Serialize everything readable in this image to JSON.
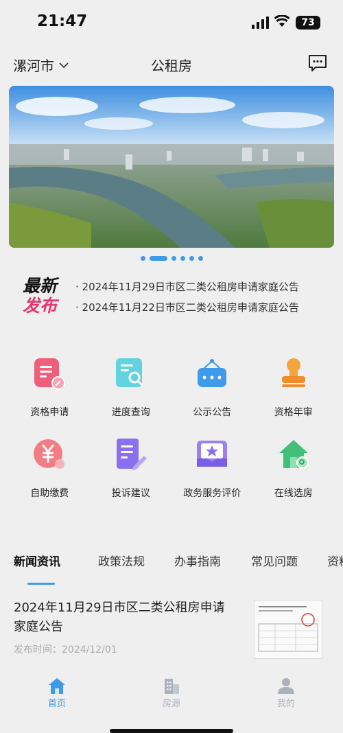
{
  "status_bar": {
    "time": "21:47",
    "battery": "73"
  },
  "header": {
    "city": "漯河市",
    "title": "公租房"
  },
  "banner": {
    "slide_count": 6,
    "active_index": 1
  },
  "latest_news": {
    "logo_line1": "最新",
    "logo_line2": "发布",
    "items": [
      "· 2024年11月29日市区二类公租房申请家庭公告",
      "· 2024年11月22日市区二类公租房申请家庭公告"
    ]
  },
  "services": [
    {
      "label": "资格申请",
      "icon": "document-edit-icon",
      "color": "#ef5f7a"
    },
    {
      "label": "进度查询",
      "icon": "document-search-icon",
      "color": "#41c6d8"
    },
    {
      "label": "公示公告",
      "icon": "notice-board-icon",
      "color": "#3d9be9"
    },
    {
      "label": "资格年审",
      "icon": "stamp-icon",
      "color": "#f08c2b"
    },
    {
      "label": "自助缴费",
      "icon": "yuan-payment-icon",
      "color": "#ef5f6e"
    },
    {
      "label": "投诉建议",
      "icon": "complaint-edit-icon",
      "color": "#8a6ff0"
    },
    {
      "label": "政务服务评价",
      "icon": "star-rating-icon",
      "color": "#8a6ff0"
    },
    {
      "label": "在线选房",
      "icon": "house-search-icon",
      "color": "#42c07a"
    }
  ],
  "tabs": [
    "新闻资讯",
    "政策法规",
    "办事指南",
    "常见问题",
    "资料"
  ],
  "article": {
    "headline": "2024年11月29日市区二类公租房申请家庭公告",
    "date": "发布时间：2024/12/01"
  },
  "bottom_nav": [
    {
      "label": "首页",
      "active": true
    },
    {
      "label": "房源",
      "active": false
    },
    {
      "label": "我的",
      "active": false
    }
  ],
  "colors": {
    "accent": "#3d9be9",
    "inactive": "#aab2bd",
    "highlight": "#e8356b"
  }
}
